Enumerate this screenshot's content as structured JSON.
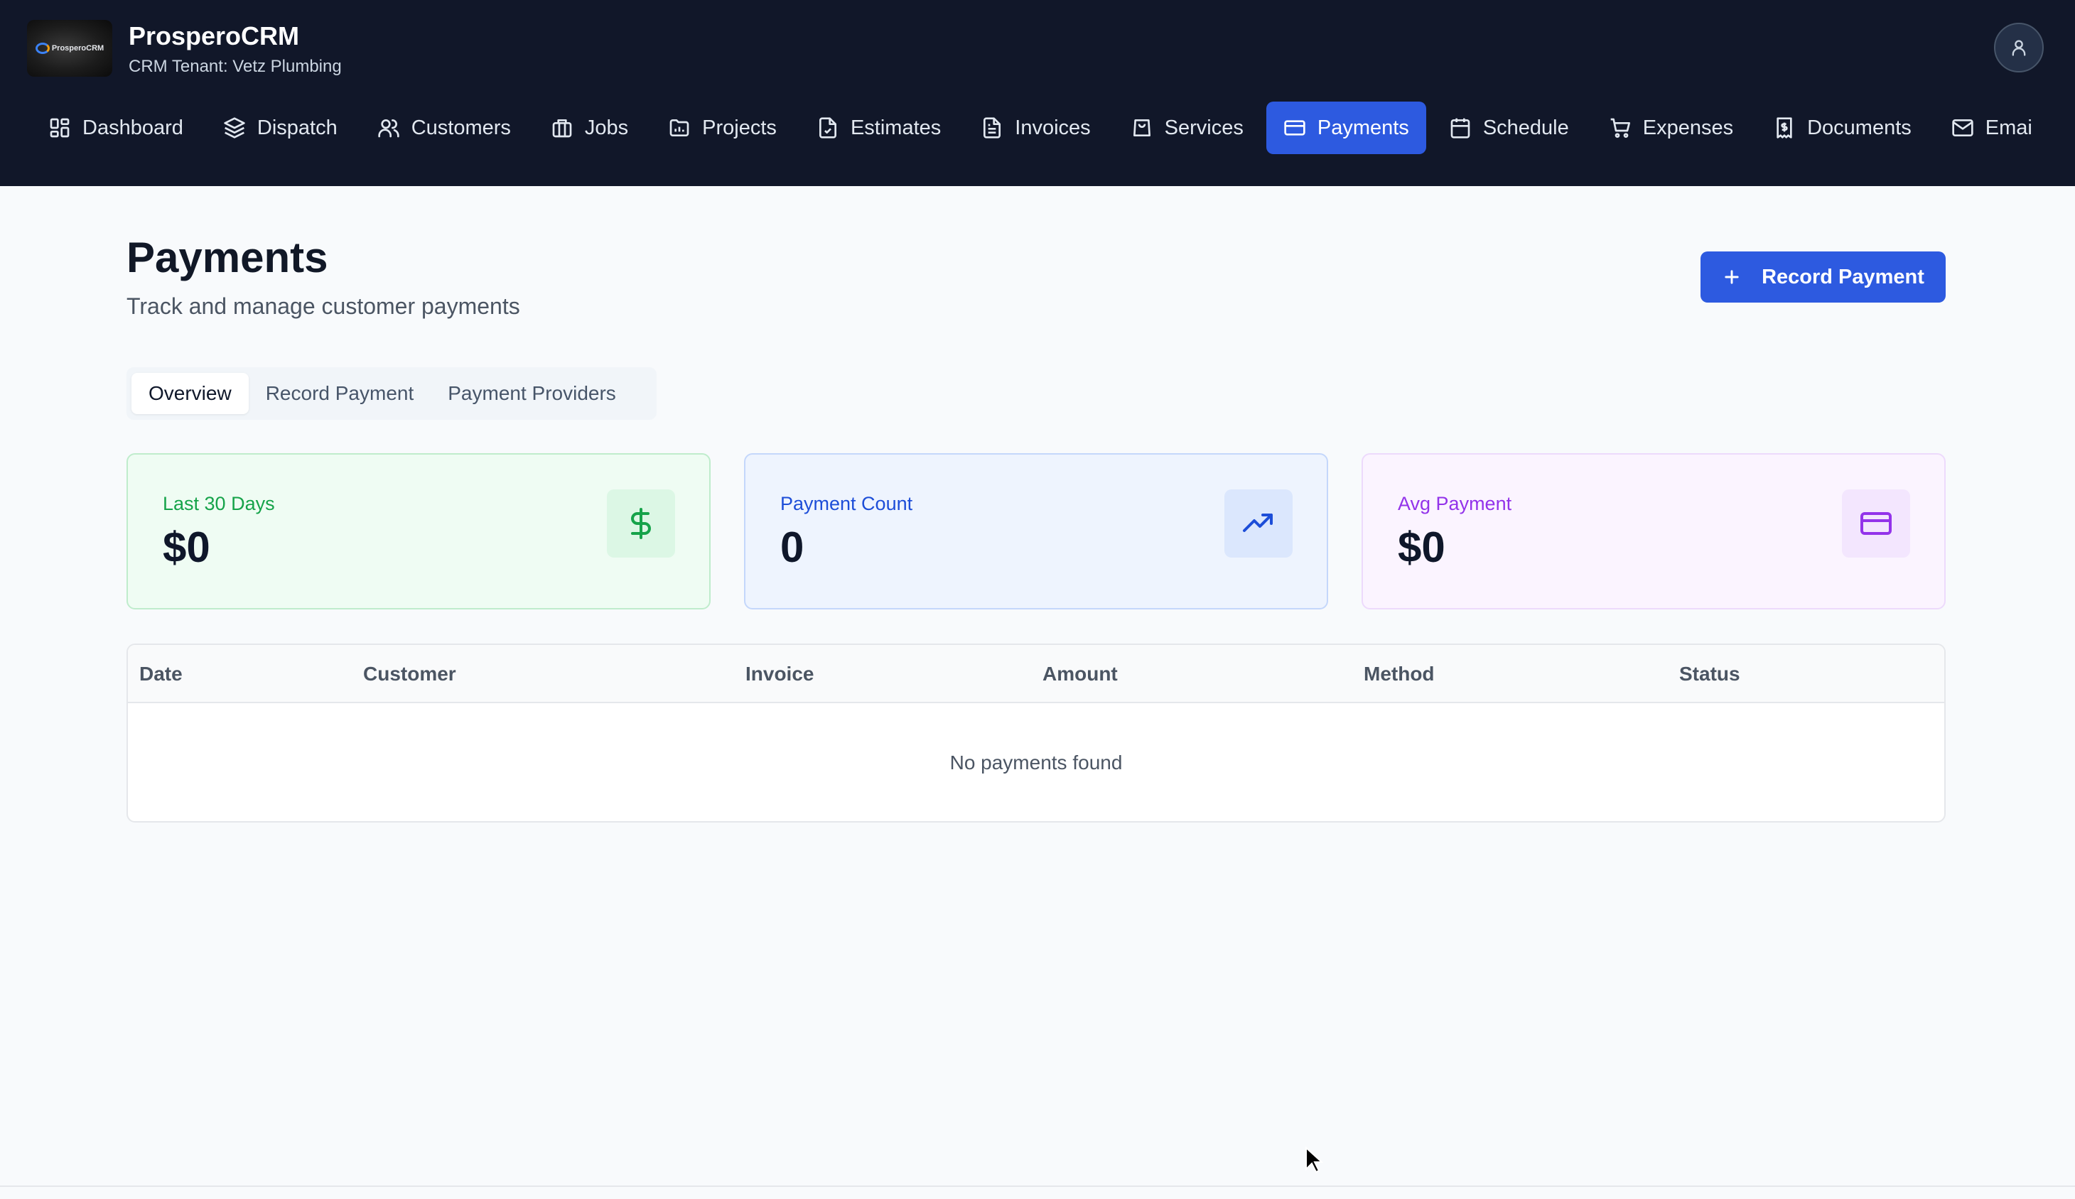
{
  "app": {
    "brand_name": "ProsperoCRM",
    "logo_text": "ProsperoCRM",
    "tenant_label": "CRM Tenant: Vetz Plumbing"
  },
  "nav": {
    "items": [
      {
        "label": "Dashboard",
        "icon": "dashboard-icon"
      },
      {
        "label": "Dispatch",
        "icon": "layers-icon"
      },
      {
        "label": "Customers",
        "icon": "users-icon"
      },
      {
        "label": "Jobs",
        "icon": "briefcase-icon"
      },
      {
        "label": "Projects",
        "icon": "folder-chart-icon"
      },
      {
        "label": "Estimates",
        "icon": "file-check-icon"
      },
      {
        "label": "Invoices",
        "icon": "file-text-icon"
      },
      {
        "label": "Services",
        "icon": "shopping-bag-icon"
      },
      {
        "label": "Payments",
        "icon": "credit-card-icon",
        "active": true
      },
      {
        "label": "Schedule",
        "icon": "calendar-icon"
      },
      {
        "label": "Expenses",
        "icon": "shopping-cart-icon"
      },
      {
        "label": "Documents",
        "icon": "receipt-icon"
      },
      {
        "label": "Emai",
        "icon": "mail-icon"
      }
    ]
  },
  "page": {
    "title": "Payments",
    "subtitle": "Track and manage customer payments",
    "record_button_label": "Record Payment"
  },
  "tabs": [
    {
      "label": "Overview",
      "active": true
    },
    {
      "label": "Record Payment"
    },
    {
      "label": "Payment Providers"
    }
  ],
  "stats": [
    {
      "label": "Last 30 Days",
      "value": "$0",
      "icon": "dollar-icon",
      "color": "#16a34a"
    },
    {
      "label": "Payment Count",
      "value": "0",
      "icon": "trending-up-icon",
      "color": "#1d4ed8"
    },
    {
      "label": "Avg Payment",
      "value": "$0",
      "icon": "credit-card-icon",
      "color": "#9333ea"
    }
  ],
  "table": {
    "columns": [
      "Date",
      "Customer",
      "Invoice",
      "Amount",
      "Method",
      "Status"
    ],
    "empty_message": "No payments found"
  },
  "colors": {
    "topbar": "#111729",
    "accent": "#2d5ae0",
    "background": "#f8fafc"
  }
}
